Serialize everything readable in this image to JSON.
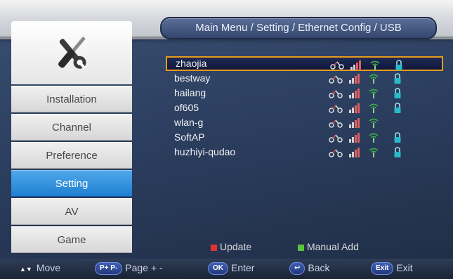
{
  "breadcrumb": "Main Menu / Setting / Ethernet Config / USB",
  "menu": {
    "items": [
      {
        "label": "Installation"
      },
      {
        "label": "Channel"
      },
      {
        "label": "Preference"
      },
      {
        "label": "Setting",
        "active": true
      },
      {
        "label": "AV"
      },
      {
        "label": "Game"
      }
    ]
  },
  "networks": [
    {
      "name": "zhaojia",
      "selected": true,
      "lock": true
    },
    {
      "name": "bestway",
      "lock": true
    },
    {
      "name": "hailang",
      "lock": true
    },
    {
      "name": "of605",
      "lock": true
    },
    {
      "name": "wlan-g",
      "lock": false
    },
    {
      "name": "SoftAP",
      "lock": true
    },
    {
      "name": "huzhiyi-qudao",
      "lock": true
    }
  ],
  "legend": {
    "update_label": "Update",
    "update_color": "#e03232",
    "manual_add_label": "Manual Add",
    "manual_add_color": "#5cc23c"
  },
  "helpbar": {
    "move_key": "▲▼",
    "move_label": "Move",
    "page_key": "P+ P-",
    "page_label": "Page + -",
    "enter_key": "OK",
    "enter_label": "Enter",
    "back_key": "↩",
    "back_label": "Back",
    "exit_key": "Exit",
    "exit_label": "Exit"
  }
}
